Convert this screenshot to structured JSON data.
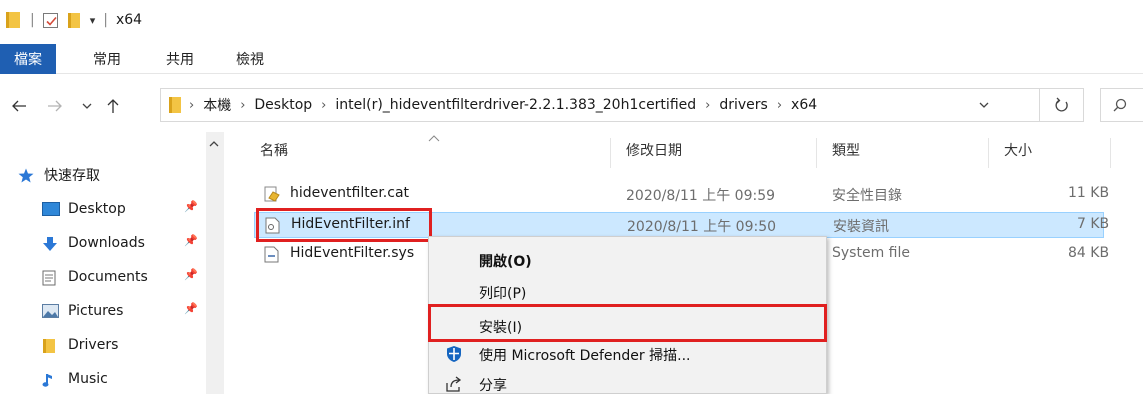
{
  "window": {
    "title": "x64",
    "quick_access_dropdown": "▾"
  },
  "ribbon": {
    "tabs": [
      {
        "label": "檔案",
        "active": true
      },
      {
        "label": "常用"
      },
      {
        "label": "共用"
      },
      {
        "label": "檢視"
      }
    ]
  },
  "address": {
    "breadcrumbs": [
      "本機",
      "Desktop",
      "intel(r)_hideventfilterdriver-2.2.1.383_20h1certified",
      "drivers",
      "x64"
    ],
    "separator": "›"
  },
  "sidebar": {
    "items": [
      {
        "label": "快速存取",
        "icon": "star-icon",
        "pinned": false
      },
      {
        "label": "Desktop",
        "icon": "desktop-icon",
        "pinned": true
      },
      {
        "label": "Downloads",
        "icon": "download-icon",
        "pinned": true
      },
      {
        "label": "Documents",
        "icon": "documents-icon",
        "pinned": true
      },
      {
        "label": "Pictures",
        "icon": "pictures-icon",
        "pinned": true
      },
      {
        "label": "Drivers",
        "icon": "folder-icon",
        "pinned": false
      },
      {
        "label": "Music",
        "icon": "music-icon",
        "pinned": false
      }
    ]
  },
  "filelist": {
    "columns": [
      "名稱",
      "修改日期",
      "類型",
      "大小"
    ],
    "rows": [
      {
        "name": "hideventfilter.cat",
        "date": "2020/8/11 上午 09:59",
        "type": "安全性目錄",
        "size": "11 KB",
        "icon": "catalog-file-icon"
      },
      {
        "name": "HidEventFilter.inf",
        "date": "2020/8/11 上午 09:50",
        "type": "安裝資訊",
        "size": "7 KB",
        "icon": "inf-file-icon",
        "selected": true
      },
      {
        "name": "HidEventFilter.sys",
        "date": "",
        "type": "System file",
        "size": "84 KB",
        "icon": "sys-file-icon"
      }
    ]
  },
  "context_menu": {
    "items": [
      {
        "label": "開啟(O)",
        "bold": true
      },
      {
        "label": "列印(P)"
      },
      {
        "label": "安裝(I)",
        "highlighted": true
      },
      {
        "label": "使用 Microsoft Defender 掃描...",
        "icon": "defender-shield-icon"
      },
      {
        "label": "分享",
        "icon": "share-icon"
      }
    ]
  },
  "colors": {
    "accent": "#1f5fb2",
    "selection": "#cce8ff",
    "highlight_box": "#e02020"
  }
}
